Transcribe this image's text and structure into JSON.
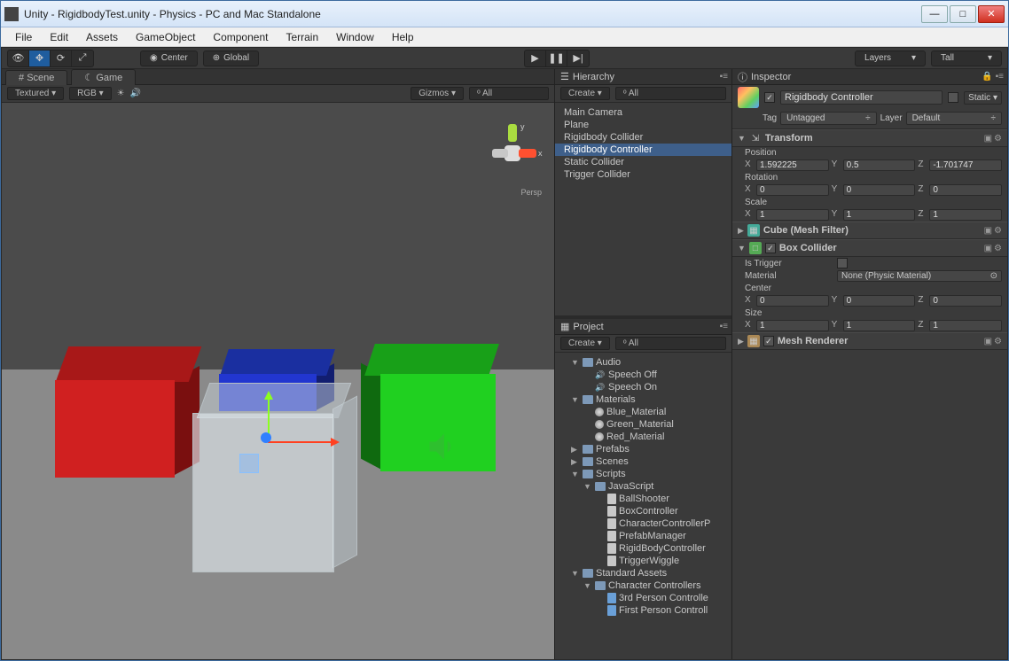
{
  "window": {
    "title": "Unity - RigidbodyTest.unity - Physics - PC and Mac Standalone"
  },
  "menubar": [
    "File",
    "Edit",
    "Assets",
    "GameObject",
    "Component",
    "Terrain",
    "Window",
    "Help"
  ],
  "toolbar": {
    "pivot": "Center",
    "handle": "Global",
    "layers": "Layers",
    "layout": "Tall"
  },
  "scene": {
    "tab_scene": "Scene",
    "tab_game": "Game",
    "shading": "Textured",
    "render": "RGB",
    "gizmos": "Gizmos",
    "search": "All",
    "persp": "Persp",
    "axis_y": "y",
    "axis_x": "x"
  },
  "hierarchy": {
    "title": "Hierarchy",
    "create": "Create",
    "search": "All",
    "items": [
      "Main Camera",
      "Plane",
      "Rigidbody Collider",
      "Rigidbody Controller",
      "Static Collider",
      "Trigger Collider"
    ],
    "selected_index": 3
  },
  "project": {
    "title": "Project",
    "create": "Create",
    "search": "All",
    "tree": [
      {
        "depth": 1,
        "kind": "folder",
        "label": "Audio",
        "open": true
      },
      {
        "depth": 2,
        "kind": "sound",
        "label": "Speech Off"
      },
      {
        "depth": 2,
        "kind": "sound",
        "label": "Speech On"
      },
      {
        "depth": 1,
        "kind": "folder",
        "label": "Materials",
        "open": true
      },
      {
        "depth": 2,
        "kind": "ball",
        "label": "Blue_Material"
      },
      {
        "depth": 2,
        "kind": "ball",
        "label": "Green_Material"
      },
      {
        "depth": 2,
        "kind": "ball",
        "label": "Red_Material"
      },
      {
        "depth": 1,
        "kind": "folder",
        "label": "Prefabs",
        "open": false
      },
      {
        "depth": 1,
        "kind": "folder",
        "label": "Scenes",
        "open": false
      },
      {
        "depth": 1,
        "kind": "folder",
        "label": "Scripts",
        "open": true
      },
      {
        "depth": 2,
        "kind": "folder",
        "label": "JavaScript",
        "open": true
      },
      {
        "depth": 3,
        "kind": "file",
        "label": "BallShooter"
      },
      {
        "depth": 3,
        "kind": "file",
        "label": "BoxController"
      },
      {
        "depth": 3,
        "kind": "file",
        "label": "CharacterControllerP"
      },
      {
        "depth": 3,
        "kind": "file",
        "label": "PrefabManager"
      },
      {
        "depth": 3,
        "kind": "file",
        "label": "RigidBodyController"
      },
      {
        "depth": 3,
        "kind": "file",
        "label": "TriggerWiggle"
      },
      {
        "depth": 1,
        "kind": "folder",
        "label": "Standard Assets",
        "open": true
      },
      {
        "depth": 2,
        "kind": "folder",
        "label": "Character Controllers",
        "open": true
      },
      {
        "depth": 3,
        "kind": "prefab",
        "label": "3rd Person Controlle"
      },
      {
        "depth": 3,
        "kind": "prefab",
        "label": "First Person Controll"
      }
    ]
  },
  "inspector": {
    "title": "Inspector",
    "object_name": "Rigidbody Controller",
    "static": "Static",
    "tag_lbl": "Tag",
    "tag_val": "Untagged",
    "layer_lbl": "Layer",
    "layer_val": "Default",
    "transform": {
      "title": "Transform",
      "pos_lbl": "Position",
      "rot_lbl": "Rotation",
      "scale_lbl": "Scale",
      "pos": {
        "x": "1.592225",
        "y": "0.5",
        "z": "-1.701747"
      },
      "rot": {
        "x": "0",
        "y": "0",
        "z": "0"
      },
      "scale": {
        "x": "1",
        "y": "1",
        "z": "1"
      }
    },
    "meshfilter": {
      "title": "Cube (Mesh Filter)"
    },
    "boxcollider": {
      "title": "Box Collider",
      "istrigger_lbl": "Is Trigger",
      "material_lbl": "Material",
      "material_val": "None (Physic Material)",
      "center_lbl": "Center",
      "center": {
        "x": "0",
        "y": "0",
        "z": "0"
      },
      "size_lbl": "Size",
      "size": {
        "x": "1",
        "y": "1",
        "z": "1"
      }
    },
    "meshrenderer": {
      "title": "Mesh Renderer"
    }
  }
}
